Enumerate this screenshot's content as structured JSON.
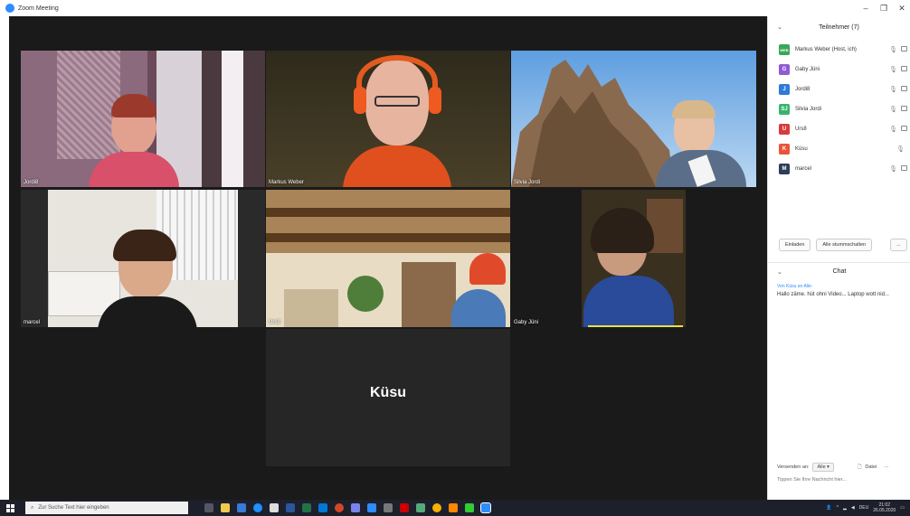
{
  "window": {
    "title": "Zoom Meeting"
  },
  "tiles": [
    {
      "name": "Jordi8",
      "active": false
    },
    {
      "name": "Markus Weber",
      "active": false
    },
    {
      "name": "Silvia Jordi",
      "active": true
    },
    {
      "name": "marcel",
      "active": false
    },
    {
      "name": "Urs8",
      "active": false
    },
    {
      "name": "Gaby Jüni",
      "active": false
    },
    {
      "name": "Küsu",
      "active": false
    }
  ],
  "panel": {
    "title": "Teilnehmer (7)",
    "participants": [
      {
        "label": "Markus Weber (Host, ich)",
        "avatar": "WEB",
        "color": "#3aa757"
      },
      {
        "label": "Gaby Jüni",
        "avatar": "G",
        "color": "#8e5bd6"
      },
      {
        "label": "Jordi8",
        "avatar": "J",
        "color": "#2d7bd8"
      },
      {
        "label": "Silvia Jordi",
        "avatar": "SJ",
        "color": "#39b36a"
      },
      {
        "label": "Urs8",
        "avatar": "U",
        "color": "#d93b3b"
      },
      {
        "label": "Küsu",
        "avatar": "K",
        "color": "#e8553a"
      },
      {
        "label": "marcel",
        "avatar": "M",
        "color": "#2e3d5a"
      }
    ],
    "invite_label": "Einladen",
    "mute_all_label": "Alle stummschalten",
    "more_label": "..."
  },
  "chat": {
    "title": "Chat",
    "from": "Von Küsu an Alle:",
    "message": "Hallo zäme. hüt ohni Video... Laptop wott nid...",
    "send_to_label": "Versenden an:",
    "send_to_value": "Alle",
    "file_label": "Datei",
    "input_placeholder": "Tippen Sie Ihre Nachricht hier..."
  },
  "taskbar": {
    "search_placeholder": "Zur Suche Text hier eingeben",
    "lang": "DEU",
    "time": "21:02",
    "date": "26.05.2020"
  }
}
